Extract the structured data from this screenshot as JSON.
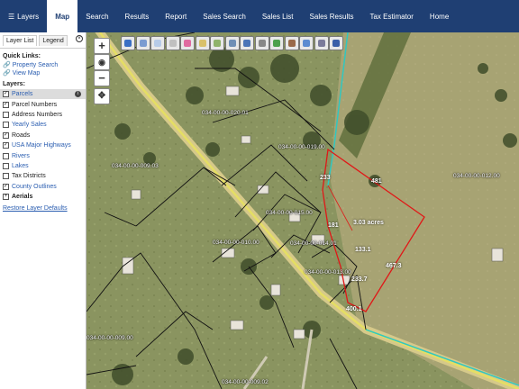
{
  "nav": {
    "layers": "Layers",
    "map": "Map",
    "search": "Search",
    "results": "Results",
    "report": "Report",
    "sales_search": "Sales Search",
    "sales_list": "Sales List",
    "sales_results": "Sales Results",
    "tax_estimator": "Tax Estimator",
    "home": "Home"
  },
  "sidebar": {
    "tabs": [
      "Layer List",
      "Legend"
    ],
    "quick_links_title": "Quick Links:",
    "quick_links": [
      "Property Search",
      "View Map"
    ],
    "layers_title": "Layers:",
    "layers": [
      {
        "label": "Parcels",
        "checked": true
      },
      {
        "label": "Parcel Numbers",
        "checked": true
      },
      {
        "label": "Address Numbers",
        "checked": false
      },
      {
        "label": "Yearly Sales",
        "checked": false
      },
      {
        "label": "Roads",
        "checked": true
      },
      {
        "label": "USA Major Highways",
        "checked": true
      },
      {
        "label": "Rivers",
        "checked": false
      },
      {
        "label": "Lakes",
        "checked": false
      },
      {
        "label": "Tax Districts",
        "checked": false
      },
      {
        "label": "County Outlines",
        "checked": true
      },
      {
        "label": "Aerials",
        "checked": null
      }
    ],
    "restore": "Restore Layer Defaults"
  },
  "map": {
    "parcel_labels": [
      "034-00-00-020.01",
      "034-00-00-019.00",
      "034-00-00-009.03",
      "034-00-00-015.00",
      "034-00-00-010.00",
      "034-00-00-014.01",
      "034-00-00-013.00",
      "034-00-00-012.00",
      "034-00-00-009.00",
      "034-00-00-009.02"
    ],
    "dimensions": [
      "233",
      "481",
      "181",
      "3.03 acres",
      "133.1",
      "467.3",
      "233.7",
      "400.1"
    ]
  }
}
